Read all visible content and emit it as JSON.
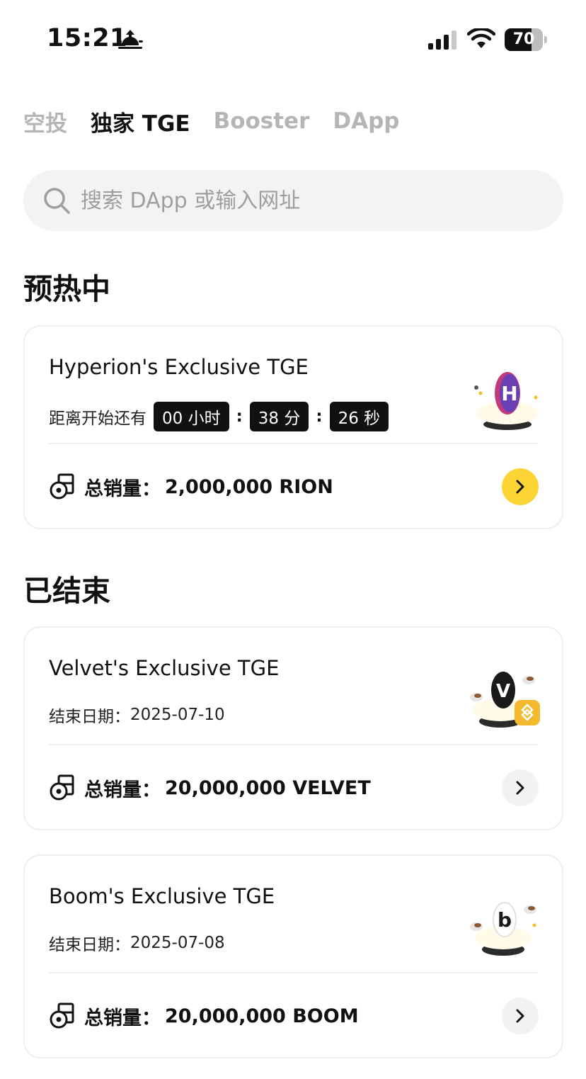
{
  "status_bar": {
    "time": "15:21",
    "battery_level": "70",
    "icons": [
      "sunrise-icon",
      "signal-icon",
      "wifi-icon",
      "battery-icon"
    ]
  },
  "tabs": [
    {
      "label": "空投",
      "active": false
    },
    {
      "label": "独家 TGE",
      "active": true
    },
    {
      "label": "Booster",
      "active": false
    },
    {
      "label": "DApp",
      "active": false
    }
  ],
  "search": {
    "placeholder": "搜索 DApp 或输入网址"
  },
  "sections": {
    "upcoming_title": "预热中",
    "ended_title": "已结束"
  },
  "upcoming": {
    "title": "Hyperion's Exclusive TGE",
    "countdown_label": "距离开始还有",
    "countdown": {
      "hours": "00 小时",
      "minutes": "38 分",
      "seconds": "26 秒",
      "separator": ":"
    },
    "supply_label": "总销量：",
    "supply_value": "2,000,000 RION",
    "token_letter": "H",
    "token_color": "#c23a7a"
  },
  "ended": [
    {
      "title": "Velvet's Exclusive TGE",
      "end_label": "结束日期：",
      "end_date": "2025-07-10",
      "supply_label": "总销量：",
      "supply_value": "20,000,000 VELVET",
      "token_letter": "V",
      "token_color": "#1a1a1a"
    },
    {
      "title": "Boom's Exclusive TGE",
      "end_label": "结束日期：",
      "end_date": "2025-07-08",
      "supply_label": "总销量：",
      "supply_value": "20,000,000 BOOM",
      "token_letter": "b",
      "token_color": "#1a1a1a"
    }
  ],
  "colors": {
    "accent": "#fcd535",
    "text": "#111111",
    "muted_tab": "#b5b5b5",
    "search_bg": "#f3f3f3"
  }
}
